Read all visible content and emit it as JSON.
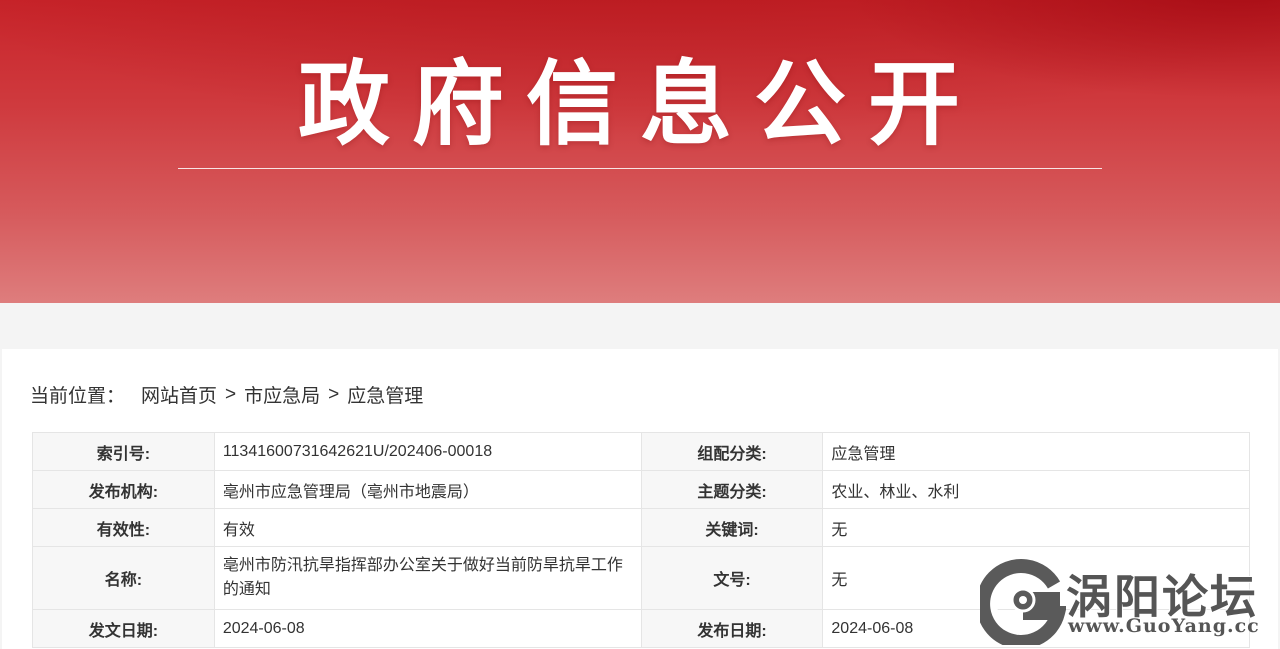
{
  "banner": {
    "title": "政府信息公开"
  },
  "breadcrumb": {
    "lead": "当前位置：",
    "items": [
      "网站首页",
      "市应急局",
      "应急管理"
    ],
    "separator": ">"
  },
  "meta": {
    "rows": [
      {
        "l1": "索引号:",
        "v1": "11341600731642621U/202406-00018",
        "l2": "组配分类:",
        "v2": "应急管理"
      },
      {
        "l1": "发布机构:",
        "v1": "亳州市应急管理局（亳州市地震局）",
        "l2": "主题分类:",
        "v2": "农业、林业、水利"
      },
      {
        "l1": "有效性:",
        "v1": "有效",
        "l2": "关键词:",
        "v2": "无"
      },
      {
        "l1": "名称:",
        "v1": "亳州市防汛抗旱指挥部办公室关于做好当前防旱抗旱工作的通知",
        "l2": "文号:",
        "v2": "无"
      },
      {
        "l1": "发文日期:",
        "v1": "2024-06-08",
        "l2": "发布日期:",
        "v2": "2024-06-08"
      }
    ]
  },
  "watermark": {
    "name": "涡阳论坛",
    "url": "www.GuoYang.cc"
  },
  "colors": {
    "banner_red": "#c8242a",
    "label_bg": "#f7f7f7",
    "border": "#e5e5e5"
  }
}
